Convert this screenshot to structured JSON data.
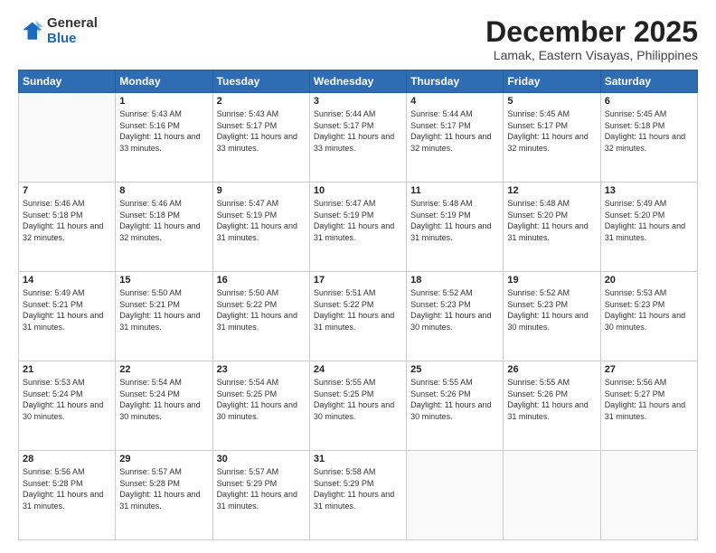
{
  "logo": {
    "general": "General",
    "blue": "Blue"
  },
  "title": "December 2025",
  "location": "Lamak, Eastern Visayas, Philippines",
  "weekdays": [
    "Sunday",
    "Monday",
    "Tuesday",
    "Wednesday",
    "Thursday",
    "Friday",
    "Saturday"
  ],
  "weeks": [
    [
      {
        "day": "",
        "sunrise": "",
        "sunset": "",
        "daylight": ""
      },
      {
        "day": "1",
        "sunrise": "5:43 AM",
        "sunset": "5:16 PM",
        "daylight": "11 hours and 33 minutes."
      },
      {
        "day": "2",
        "sunrise": "5:43 AM",
        "sunset": "5:17 PM",
        "daylight": "11 hours and 33 minutes."
      },
      {
        "day": "3",
        "sunrise": "5:44 AM",
        "sunset": "5:17 PM",
        "daylight": "11 hours and 33 minutes."
      },
      {
        "day": "4",
        "sunrise": "5:44 AM",
        "sunset": "5:17 PM",
        "daylight": "11 hours and 32 minutes."
      },
      {
        "day": "5",
        "sunrise": "5:45 AM",
        "sunset": "5:17 PM",
        "daylight": "11 hours and 32 minutes."
      },
      {
        "day": "6",
        "sunrise": "5:45 AM",
        "sunset": "5:18 PM",
        "daylight": "11 hours and 32 minutes."
      }
    ],
    [
      {
        "day": "7",
        "sunrise": "5:46 AM",
        "sunset": "5:18 PM",
        "daylight": "11 hours and 32 minutes."
      },
      {
        "day": "8",
        "sunrise": "5:46 AM",
        "sunset": "5:18 PM",
        "daylight": "11 hours and 32 minutes."
      },
      {
        "day": "9",
        "sunrise": "5:47 AM",
        "sunset": "5:19 PM",
        "daylight": "11 hours and 31 minutes."
      },
      {
        "day": "10",
        "sunrise": "5:47 AM",
        "sunset": "5:19 PM",
        "daylight": "11 hours and 31 minutes."
      },
      {
        "day": "11",
        "sunrise": "5:48 AM",
        "sunset": "5:19 PM",
        "daylight": "11 hours and 31 minutes."
      },
      {
        "day": "12",
        "sunrise": "5:48 AM",
        "sunset": "5:20 PM",
        "daylight": "11 hours and 31 minutes."
      },
      {
        "day": "13",
        "sunrise": "5:49 AM",
        "sunset": "5:20 PM",
        "daylight": "11 hours and 31 minutes."
      }
    ],
    [
      {
        "day": "14",
        "sunrise": "5:49 AM",
        "sunset": "5:21 PM",
        "daylight": "11 hours and 31 minutes."
      },
      {
        "day": "15",
        "sunrise": "5:50 AM",
        "sunset": "5:21 PM",
        "daylight": "11 hours and 31 minutes."
      },
      {
        "day": "16",
        "sunrise": "5:50 AM",
        "sunset": "5:22 PM",
        "daylight": "11 hours and 31 minutes."
      },
      {
        "day": "17",
        "sunrise": "5:51 AM",
        "sunset": "5:22 PM",
        "daylight": "11 hours and 31 minutes."
      },
      {
        "day": "18",
        "sunrise": "5:52 AM",
        "sunset": "5:23 PM",
        "daylight": "11 hours and 30 minutes."
      },
      {
        "day": "19",
        "sunrise": "5:52 AM",
        "sunset": "5:23 PM",
        "daylight": "11 hours and 30 minutes."
      },
      {
        "day": "20",
        "sunrise": "5:53 AM",
        "sunset": "5:23 PM",
        "daylight": "11 hours and 30 minutes."
      }
    ],
    [
      {
        "day": "21",
        "sunrise": "5:53 AM",
        "sunset": "5:24 PM",
        "daylight": "11 hours and 30 minutes."
      },
      {
        "day": "22",
        "sunrise": "5:54 AM",
        "sunset": "5:24 PM",
        "daylight": "11 hours and 30 minutes."
      },
      {
        "day": "23",
        "sunrise": "5:54 AM",
        "sunset": "5:25 PM",
        "daylight": "11 hours and 30 minutes."
      },
      {
        "day": "24",
        "sunrise": "5:55 AM",
        "sunset": "5:25 PM",
        "daylight": "11 hours and 30 minutes."
      },
      {
        "day": "25",
        "sunrise": "5:55 AM",
        "sunset": "5:26 PM",
        "daylight": "11 hours and 30 minutes."
      },
      {
        "day": "26",
        "sunrise": "5:55 AM",
        "sunset": "5:26 PM",
        "daylight": "11 hours and 31 minutes."
      },
      {
        "day": "27",
        "sunrise": "5:56 AM",
        "sunset": "5:27 PM",
        "daylight": "11 hours and 31 minutes."
      }
    ],
    [
      {
        "day": "28",
        "sunrise": "5:56 AM",
        "sunset": "5:28 PM",
        "daylight": "11 hours and 31 minutes."
      },
      {
        "day": "29",
        "sunrise": "5:57 AM",
        "sunset": "5:28 PM",
        "daylight": "11 hours and 31 minutes."
      },
      {
        "day": "30",
        "sunrise": "5:57 AM",
        "sunset": "5:29 PM",
        "daylight": "11 hours and 31 minutes."
      },
      {
        "day": "31",
        "sunrise": "5:58 AM",
        "sunset": "5:29 PM",
        "daylight": "11 hours and 31 minutes."
      },
      {
        "day": "",
        "sunrise": "",
        "sunset": "",
        "daylight": ""
      },
      {
        "day": "",
        "sunrise": "",
        "sunset": "",
        "daylight": ""
      },
      {
        "day": "",
        "sunrise": "",
        "sunset": "",
        "daylight": ""
      }
    ]
  ]
}
